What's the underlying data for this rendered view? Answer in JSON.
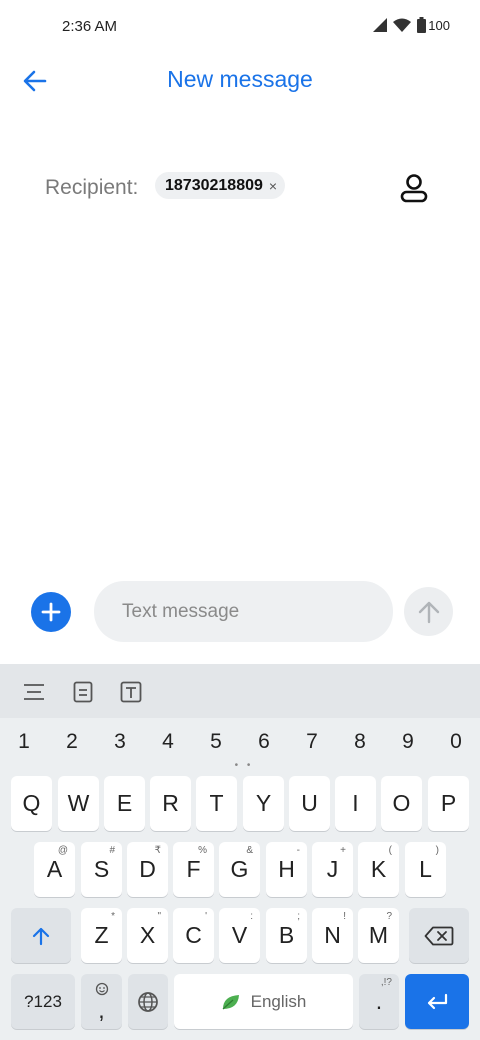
{
  "status_bar": {
    "time": "2:36 AM",
    "battery": "100"
  },
  "header": {
    "title": "New message"
  },
  "recipient": {
    "label": "Recipient:",
    "chip": "18730218809",
    "chip_remove": "×"
  },
  "compose": {
    "placeholder": "Text message"
  },
  "keyboard": {
    "numbers": [
      "1",
      "2",
      "3",
      "4",
      "5",
      "6",
      "7",
      "8",
      "9",
      "0"
    ],
    "row1": [
      "Q",
      "W",
      "E",
      "R",
      "T",
      "Y",
      "U",
      "I",
      "O",
      "P"
    ],
    "row2": [
      "A",
      "S",
      "D",
      "F",
      "G",
      "H",
      "J",
      "K",
      "L"
    ],
    "row2_hints": [
      "@",
      "#",
      "₹",
      "%",
      "&",
      "-",
      "+",
      "(",
      ")"
    ],
    "row3": [
      "Z",
      "X",
      "C",
      "V",
      "B",
      "N",
      "M"
    ],
    "row3_hints": [
      "*",
      "\"",
      "'",
      ":",
      ";",
      "!",
      "?"
    ],
    "symbols_label": "?123",
    "comma": ",",
    "space_label": "English",
    "period": ".",
    "period_hint": ",!?"
  },
  "colors": {
    "accent": "#1a73e8",
    "keyboard_bg": "#eceff1"
  }
}
